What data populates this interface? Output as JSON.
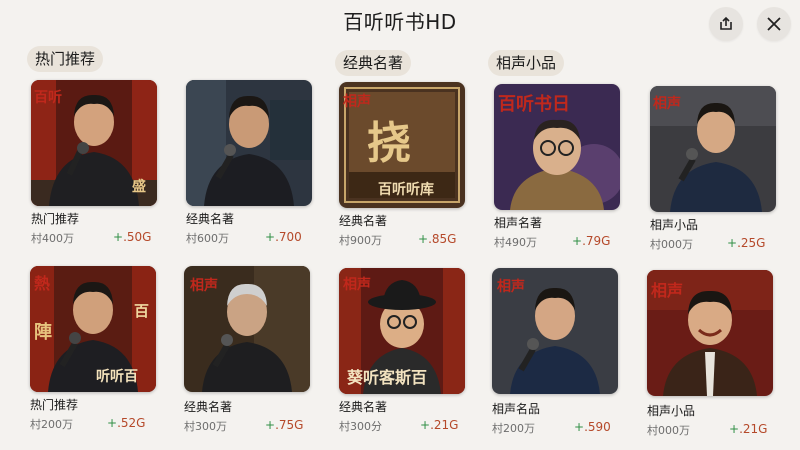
{
  "app": {
    "title": "百听听书HD"
  },
  "toolbar": {
    "share_icon": "share-icon",
    "close_icon": "close-icon"
  },
  "sections": [
    "热门推荐",
    "经典名著",
    "相声小品"
  ],
  "cards": [
    {
      "tag": "百听",
      "overlay": [
        "盛"
      ],
      "caption": "热门推荐",
      "sub": "村400万",
      "price_sign": "+",
      "price": ".50G"
    },
    {
      "tag": "",
      "overlay": [],
      "caption": "经典名著",
      "sub": "村600万",
      "price_sign": "+",
      "price": ".700"
    },
    {
      "tag": "相声",
      "overlay": [
        "挠",
        "百听听库"
      ],
      "caption": "经典名著",
      "sub": "村900万",
      "price_sign": "+",
      "price": ".85G"
    },
    {
      "tag": "百听书日",
      "overlay": [],
      "caption": "相声名著",
      "sub": "村490万",
      "price_sign": "+",
      "price": ".79G"
    },
    {
      "tag": "相声",
      "overlay": [],
      "caption": "相声小品",
      "sub": "村000万",
      "price_sign": "+",
      "price": ".25G"
    },
    {
      "tag": "熱",
      "overlay": [
        "百",
        "陣",
        "听听百"
      ],
      "caption": "热门推荐",
      "sub": "村200万",
      "price_sign": "+",
      "price": ".52G"
    },
    {
      "tag": "相声",
      "overlay": [],
      "caption": "经典名著",
      "sub": "村300万",
      "price_sign": "+",
      "price": ".75G"
    },
    {
      "tag": "相声",
      "overlay": [
        "葵听客斯百"
      ],
      "caption": "经典名著",
      "sub": "村300分",
      "price_sign": "+",
      "price": ".21G"
    },
    {
      "tag": "相声",
      "overlay": [],
      "caption": "相声名品",
      "sub": "村200万",
      "price_sign": "+",
      "price": ".590"
    },
    {
      "tag": "相声",
      "overlay": [],
      "caption": "相声小品",
      "sub": "村000万",
      "price_sign": "+",
      "price": ".21G"
    }
  ],
  "colors": {
    "accent": "#c0281c",
    "price": "#b5492a",
    "plus": "#2f8f45",
    "pill": "#e9e3da",
    "background": "#f4f2ef"
  }
}
